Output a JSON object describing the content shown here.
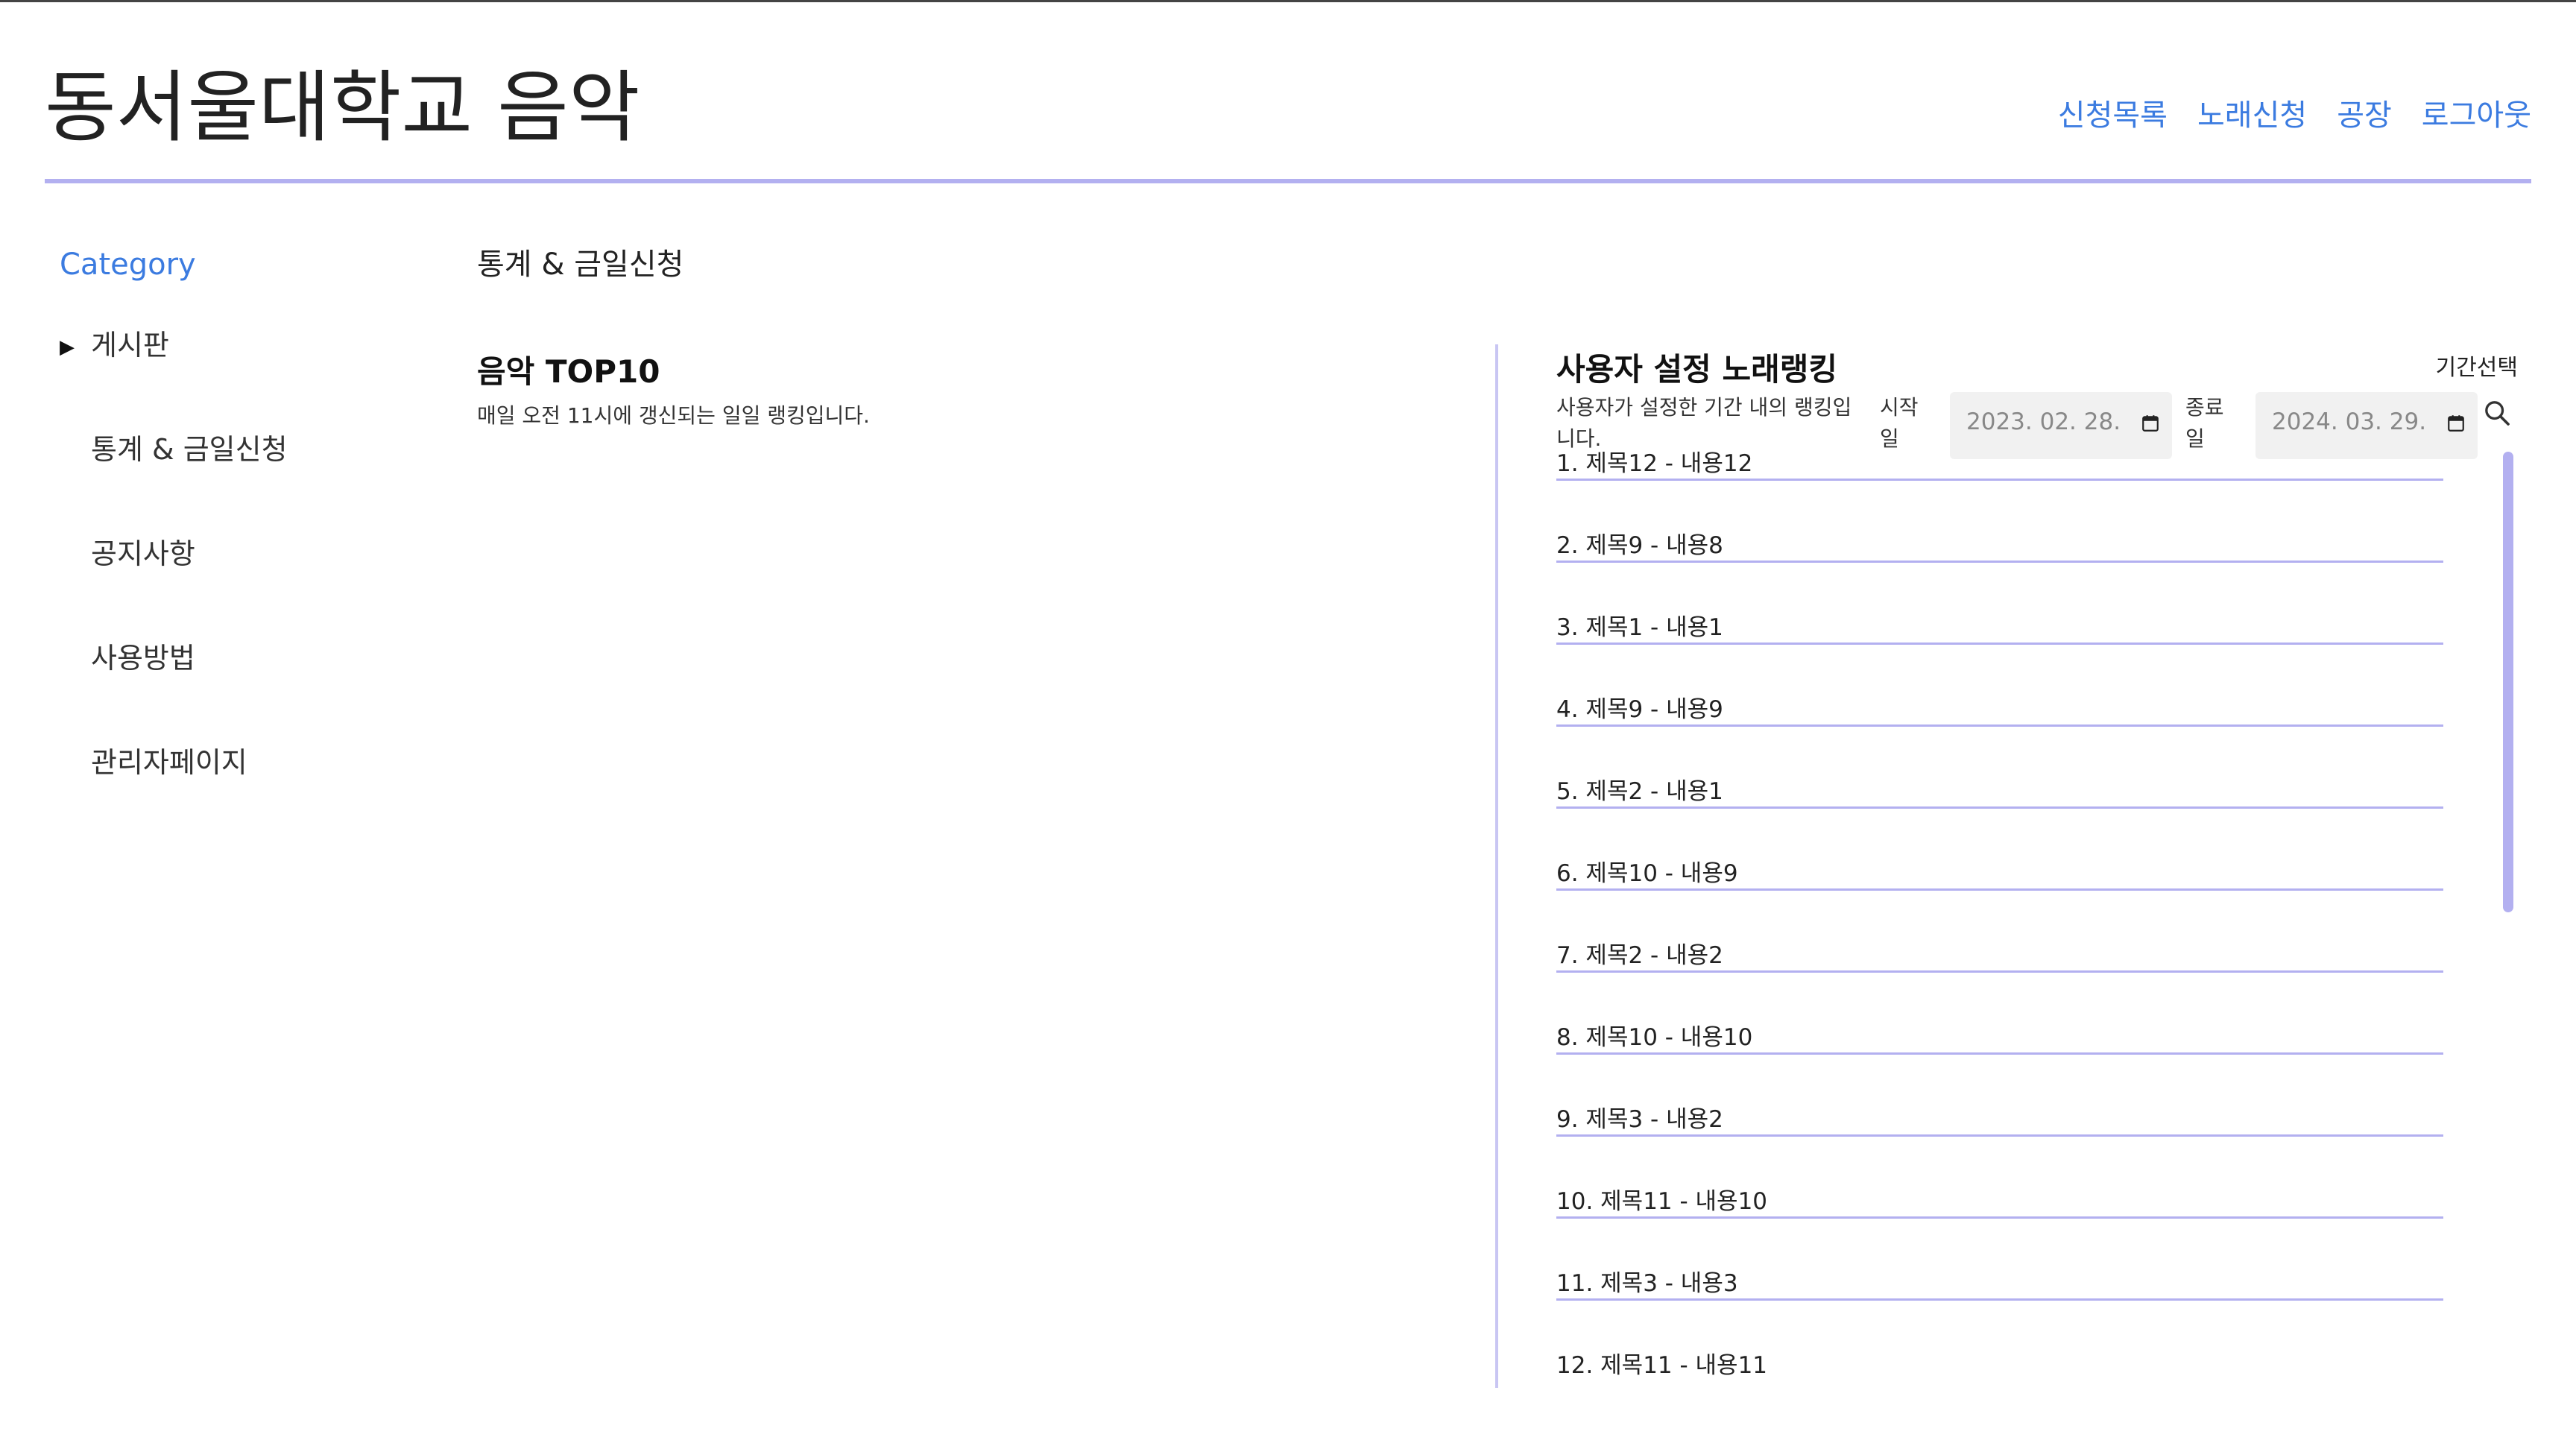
{
  "header": {
    "site_title": "동서울대학교 음악",
    "nav": [
      "신청목록",
      "노래신청",
      "공장",
      "로그아웃"
    ]
  },
  "sidebar": {
    "title": "Category",
    "items": [
      "게시판",
      "통계 & 금일신청",
      "공지사항",
      "사용방법",
      "관리자페이지"
    ]
  },
  "main": {
    "page_title": "통계 & 금일신청",
    "top10": {
      "title": "음악 TOP10",
      "subtitle": "매일 오전 11시에 갱신되는 일일 랭킹입니다."
    },
    "ranking": {
      "title": "사용자 설정 노래랭킹",
      "description": "사용자가 설정한 기간 내의 랭킹입니다.",
      "period_label": "기간선택",
      "start_label": "시작일",
      "start_date": "2023. 02. 28.",
      "end_label": "종료일",
      "end_date": "2024. 03. 29.",
      "items": [
        "1. 제목12 - 내용12",
        "2. 제목9 - 내용8",
        "3. 제목1 - 내용1",
        "4. 제목9 - 내용9",
        "5. 제목2 - 내용1",
        "6. 제목10 - 내용9",
        "7. 제목2 - 내용2",
        "8. 제목10 - 내용10",
        "9. 제목3 - 내용2",
        "10. 제목11 - 내용10",
        "11. 제목3 - 내용3",
        "12. 제목11 - 내용11"
      ]
    }
  },
  "icons": {
    "calendar": "calendar-icon",
    "search": "search-icon",
    "sidebar_expand": "triangle-right-icon"
  },
  "colors": {
    "accent_link": "#3b7be0",
    "divider": "#b3b0f0"
  }
}
